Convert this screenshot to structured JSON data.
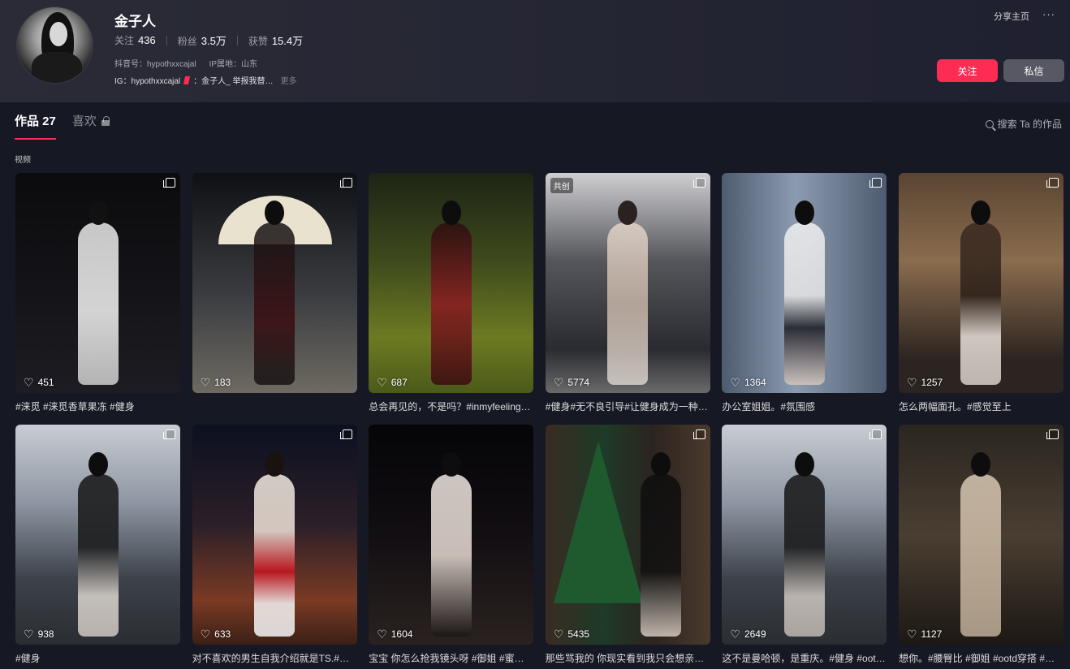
{
  "profile": {
    "name": "金子人",
    "stats": [
      {
        "label": "关注",
        "value": "436"
      },
      {
        "label": "粉丝",
        "value": "3.5万"
      },
      {
        "label": "获赞",
        "value": "15.4万"
      }
    ],
    "douyin_id": "抖音号：hypothxxcajal",
    "ip_location": "IP属地：山东",
    "bio": "IG：hypothxxcajal",
    "bio_extra": "：金子人_ 举报我替…",
    "more": "更多"
  },
  "header_actions": {
    "share_label": "分享主页",
    "more_icon": "···",
    "follow_label": "关注",
    "message_label": "私信"
  },
  "tabs": [
    {
      "label": "作品 27"
    },
    {
      "label": "喜欢"
    }
  ],
  "search": {
    "label": "搜索 Ta 的作品"
  },
  "section_title": "视频",
  "colors": {
    "accent": "#fe2c55",
    "background": "#161823"
  },
  "videos": [
    {
      "likes": "451",
      "caption": "#涞觅 #涞觅香草果冻 #健身"
    },
    {
      "likes": "183",
      "caption": ""
    },
    {
      "likes": "687",
      "caption": "总会再见的，不是吗？#inmyfeeling…"
    },
    {
      "likes": "5774",
      "caption": "#健身#无不良引导#让健身成为一种…",
      "badge": "共创"
    },
    {
      "likes": "1364",
      "caption": "办公室姐姐。#氛围感"
    },
    {
      "likes": "1257",
      "caption": "怎么两幅面孔。#感觉至上"
    },
    {
      "likes": "938",
      "caption": "#健身"
    },
    {
      "likes": "633",
      "caption": "对不喜欢的男生自我介绍就是TS.#氛…"
    },
    {
      "likes": "1604",
      "caption": "宝宝 你怎么抢我镜头呀 #御姐 #蜜大…"
    },
    {
      "likes": "5435",
      "caption": "那些骂我的 你现实看到我只会想亲…"
    },
    {
      "likes": "2649",
      "caption": "这不是曼哈顿，是重庆。#健身 #oot…"
    },
    {
      "likes": "1127",
      "caption": "想你。#腰臀比 #御姐 #ootd穿搭 #…"
    }
  ]
}
